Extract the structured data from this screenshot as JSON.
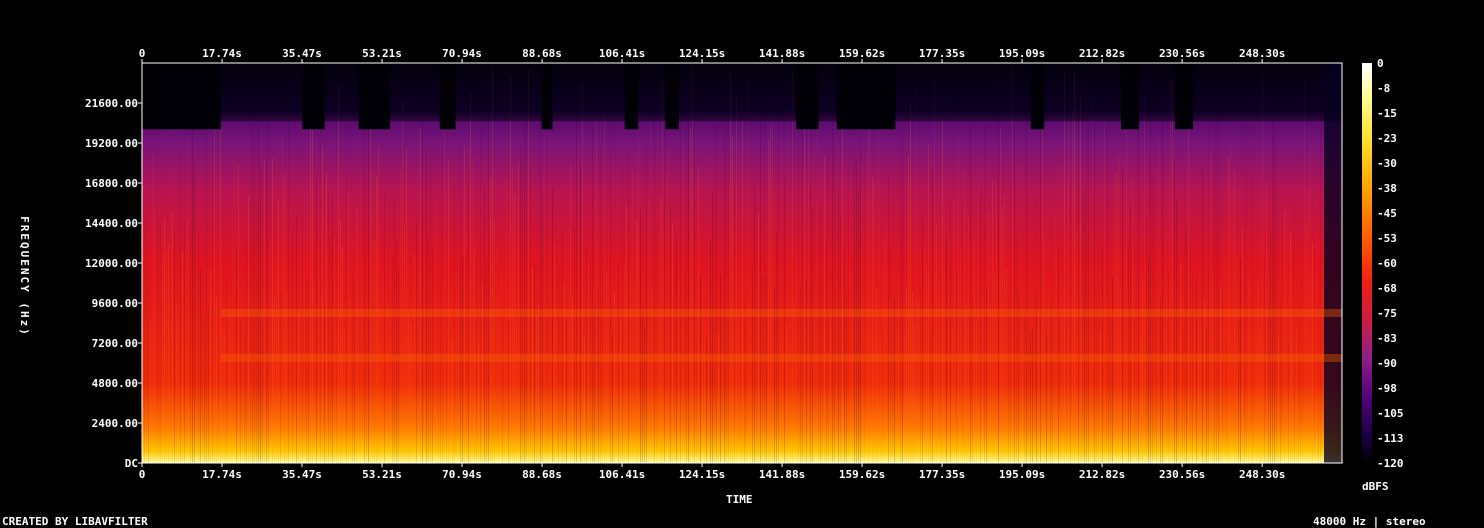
{
  "chart_data": {
    "type": "heatmap",
    "title": "",
    "xlabel": "TIME",
    "ylabel": "FREQUENCY (Hz)",
    "x_ticks": [
      "0",
      "17.74s",
      "35.47s",
      "53.21s",
      "70.94s",
      "88.68s",
      "106.41s",
      "124.15s",
      "141.88s",
      "159.62s",
      "177.35s",
      "195.09s",
      "212.82s",
      "230.56s",
      "248.30s"
    ],
    "x_tick_values_s": [
      0,
      17.74,
      35.47,
      53.21,
      70.94,
      88.68,
      106.41,
      124.15,
      141.88,
      159.62,
      177.35,
      195.09,
      212.82,
      230.56,
      248.3
    ],
    "xlim_s": [
      0,
      266
    ],
    "y_ticks": [
      "DC",
      "2400.00",
      "4800.00",
      "7200.00",
      "9600.00",
      "12000.00",
      "14400.00",
      "16800.00",
      "19200.00",
      "21600.00"
    ],
    "y_tick_values_hz": [
      0,
      2400,
      4800,
      7200,
      9600,
      12000,
      14400,
      16800,
      19200,
      21600
    ],
    "ylim_hz": [
      0,
      24000
    ],
    "colorbar": {
      "label": "dBFS",
      "ticks": [
        "0",
        "-8",
        "-15",
        "-23",
        "-30",
        "-38",
        "-45",
        "-53",
        "-60",
        "-68",
        "-75",
        "-83",
        "-90",
        "-98",
        "-105",
        "-113",
        "-120"
      ],
      "range_db": [
        -120,
        0
      ],
      "colormap": [
        "#000000",
        "#1a0046",
        "#500078",
        "#8c1e8c",
        "#c81e46",
        "#f01e14",
        "#ff5a00",
        "#ffa000",
        "#ffdc28",
        "#ffff96",
        "#ffffff"
      ]
    },
    "lowpass_cutoff_hz": 20500,
    "quiet_segments_s": [
      [
        0,
        17.5
      ],
      [
        35.5,
        40.5
      ],
      [
        48,
        55
      ],
      [
        66,
        69.5
      ],
      [
        88.6,
        91
      ],
      [
        107,
        110
      ],
      [
        116,
        119
      ],
      [
        145,
        150
      ],
      [
        154,
        167
      ],
      [
        197,
        200
      ],
      [
        217,
        221
      ],
      [
        229,
        233
      ]
    ],
    "harmonic_bands_hz": [
      6300,
      9000
    ]
  },
  "footer": {
    "left": "CREATED BY LIBAVFILTER",
    "right": "48000 Hz | stereo"
  }
}
